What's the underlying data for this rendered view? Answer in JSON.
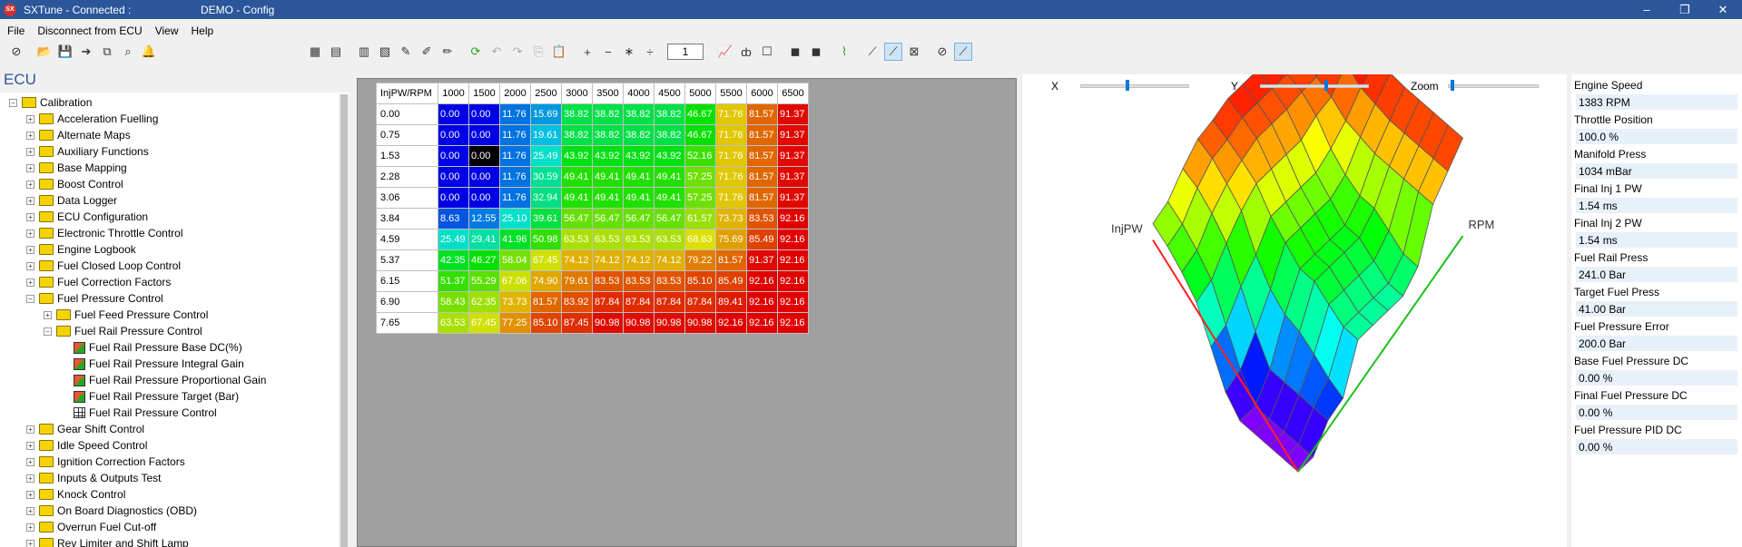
{
  "window": {
    "app_title": "SXTune - Connected :",
    "doc_title": "DEMO - Config",
    "app_icon": "SX",
    "minimize": "–",
    "restore": "❐",
    "close": "✕"
  },
  "menu": [
    "File",
    "Disconnect from ECU",
    "View",
    "Help"
  ],
  "toolbar": {
    "step_value": "1"
  },
  "sidebar": {
    "title": "ECU",
    "tree": [
      {
        "label": "Calibration",
        "level": 0,
        "icon": "calibration",
        "exp": "−"
      },
      {
        "label": "Acceleration Fuelling",
        "level": 1,
        "icon": "folder",
        "exp": "+"
      },
      {
        "label": "Alternate Maps",
        "level": 1,
        "icon": "folder",
        "exp": "+"
      },
      {
        "label": "Auxiliary Functions",
        "level": 1,
        "icon": "folder",
        "exp": "+"
      },
      {
        "label": "Base Mapping",
        "level": 1,
        "icon": "folder",
        "exp": "+"
      },
      {
        "label": "Boost Control",
        "level": 1,
        "icon": "folder",
        "exp": "+"
      },
      {
        "label": "Data Logger",
        "level": 1,
        "icon": "folder",
        "exp": "+"
      },
      {
        "label": "ECU Configuration",
        "level": 1,
        "icon": "folder",
        "exp": "+"
      },
      {
        "label": "Electronic Throttle Control",
        "level": 1,
        "icon": "folder",
        "exp": "+"
      },
      {
        "label": "Engine Logbook",
        "level": 1,
        "icon": "folder",
        "exp": "+"
      },
      {
        "label": "Fuel Closed Loop Control",
        "level": 1,
        "icon": "folder",
        "exp": "+"
      },
      {
        "label": "Fuel Correction Factors",
        "level": 1,
        "icon": "folder",
        "exp": "+"
      },
      {
        "label": "Fuel Pressure Control",
        "level": 1,
        "icon": "folder",
        "exp": "−"
      },
      {
        "label": "Fuel Feed Pressure Control",
        "level": 2,
        "icon": "folder",
        "exp": "+"
      },
      {
        "label": "Fuel Rail Pressure Control",
        "level": 2,
        "icon": "folder",
        "exp": "−"
      },
      {
        "label": "Fuel Rail Pressure Base DC(%)",
        "level": 3,
        "icon": "cube",
        "exp": "",
        "selected": true
      },
      {
        "label": "Fuel Rail Pressure Integral Gain",
        "level": 3,
        "icon": "cube",
        "exp": ""
      },
      {
        "label": "Fuel Rail Pressure Proportional Gain",
        "level": 3,
        "icon": "cube",
        "exp": ""
      },
      {
        "label": "Fuel Rail Pressure Target (Bar)",
        "level": 3,
        "icon": "cube",
        "exp": ""
      },
      {
        "label": "Fuel Rail Pressure Control",
        "level": 3,
        "icon": "grid",
        "exp": ""
      },
      {
        "label": "Gear Shift Control",
        "level": 1,
        "icon": "folder",
        "exp": "+"
      },
      {
        "label": "Idle Speed Control",
        "level": 1,
        "icon": "folder",
        "exp": "+"
      },
      {
        "label": "Ignition Correction Factors",
        "level": 1,
        "icon": "folder",
        "exp": "+"
      },
      {
        "label": "Inputs & Outputs Test",
        "level": 1,
        "icon": "folder",
        "exp": "+"
      },
      {
        "label": "Knock Control",
        "level": 1,
        "icon": "folder",
        "exp": "+"
      },
      {
        "label": "On Board Diagnostics (OBD)",
        "level": 1,
        "icon": "folder",
        "exp": "+"
      },
      {
        "label": "Overrun Fuel Cut-off",
        "level": 1,
        "icon": "folder",
        "exp": "+"
      },
      {
        "label": "Rev Limiter and Shift Lamp",
        "level": 1,
        "icon": "folder",
        "exp": "+"
      }
    ]
  },
  "map_table": {
    "corner": "InjPW/RPM",
    "columns": [
      "1000",
      "1500",
      "2000",
      "2500",
      "3000",
      "3500",
      "4000",
      "4500",
      "5000",
      "5500",
      "6000",
      "6500"
    ],
    "rows": [
      {
        "label": "0.00",
        "cells": [
          "0.00",
          "0.00",
          "11.76",
          "15.69",
          "38.82",
          "38.82",
          "38.82",
          "38.82",
          "46.67",
          "71.76",
          "81.57",
          "91.37"
        ]
      },
      {
        "label": "0.75",
        "cells": [
          "0.00",
          "0.00",
          "11.76",
          "19.61",
          "38.82",
          "38.82",
          "38.82",
          "38.82",
          "46.67",
          "71.76",
          "81.57",
          "91.37"
        ]
      },
      {
        "label": "1.53",
        "cells": [
          "0.00",
          "0.00",
          "11.76",
          "25.49",
          "43.92",
          "43.92",
          "43.92",
          "43.92",
          "52.16",
          "71.76",
          "81.57",
          "91.37"
        ]
      },
      {
        "label": "2.28",
        "cells": [
          "0.00",
          "0.00",
          "11.76",
          "30.59",
          "49.41",
          "49.41",
          "49.41",
          "49.41",
          "57.25",
          "71.76",
          "81.57",
          "91.37"
        ]
      },
      {
        "label": "3.06",
        "cells": [
          "0.00",
          "0.00",
          "11.76",
          "32.94",
          "49.41",
          "49.41",
          "49.41",
          "49.41",
          "57.25",
          "71.76",
          "81.57",
          "91.37"
        ]
      },
      {
        "label": "3.84",
        "cells": [
          "8.63",
          "12.55",
          "25.10",
          "39.61",
          "56.47",
          "56.47",
          "56.47",
          "56.47",
          "61.57",
          "73.73",
          "83.53",
          "92.16"
        ]
      },
      {
        "label": "4.59",
        "cells": [
          "25.49",
          "29.41",
          "41.96",
          "50.98",
          "63.53",
          "63.53",
          "63.53",
          "63.53",
          "68.63",
          "75.69",
          "85.49",
          "92.16"
        ]
      },
      {
        "label": "5.37",
        "cells": [
          "42.35",
          "46.27",
          "58.04",
          "67.45",
          "74.12",
          "74.12",
          "74.12",
          "74.12",
          "79.22",
          "81.57",
          "91.37",
          "92.16"
        ]
      },
      {
        "label": "6.15",
        "cells": [
          "51.37",
          "55.29",
          "67.06",
          "74.90",
          "79.61",
          "83.53",
          "83.53",
          "83.53",
          "85.10",
          "85.49",
          "92.16",
          "92.16"
        ]
      },
      {
        "label": "6.90",
        "cells": [
          "58.43",
          "62.35",
          "73.73",
          "81.57",
          "83.92",
          "87.84",
          "87.84",
          "87.84",
          "87.84",
          "89.41",
          "92.16",
          "92.16"
        ]
      },
      {
        "label": "7.65",
        "cells": [
          "63.53",
          "67.45",
          "77.25",
          "85.10",
          "87.45",
          "90.98",
          "90.98",
          "90.98",
          "90.98",
          "92.16",
          "92.16",
          "92.16"
        ]
      }
    ],
    "selected_cell": [
      2,
      1
    ],
    "selected_color": "#000000"
  },
  "view3d": {
    "x_label": "X",
    "y_label": "Y",
    "zoom_label": "Zoom",
    "x_slider": 0.42,
    "y_slider": 0.6,
    "zoom_slider": 0.02,
    "axis_injpw": "InjPW",
    "axis_rpm": "RPM",
    "axis_injpw_color": "#ff2020",
    "axis_rpm_color": "#20c020"
  },
  "info": [
    {
      "label": "Engine Speed",
      "value": "1383 RPM"
    },
    {
      "label": "Throttle Position",
      "value": "100.0 %"
    },
    {
      "label": "Manifold Press",
      "value": "1034 mBar"
    },
    {
      "label": "Final Inj 1 PW",
      "value": "1.54 ms"
    },
    {
      "label": "Final Inj 2 PW",
      "value": "1.54 ms"
    },
    {
      "label": "Fuel Rail Press",
      "value": "241.0 Bar"
    },
    {
      "label": "Target Fuel Press",
      "value": "41.00 Bar"
    },
    {
      "label": "Fuel Pressure Error",
      "value": "200.0 Bar"
    },
    {
      "label": "Base Fuel Pressure DC",
      "value": "0.00 %"
    },
    {
      "label": "Final Fuel Pressure DC",
      "value": "0.00 %"
    },
    {
      "label": "Fuel Pressure PID DC",
      "value": "0.00 %"
    }
  ]
}
